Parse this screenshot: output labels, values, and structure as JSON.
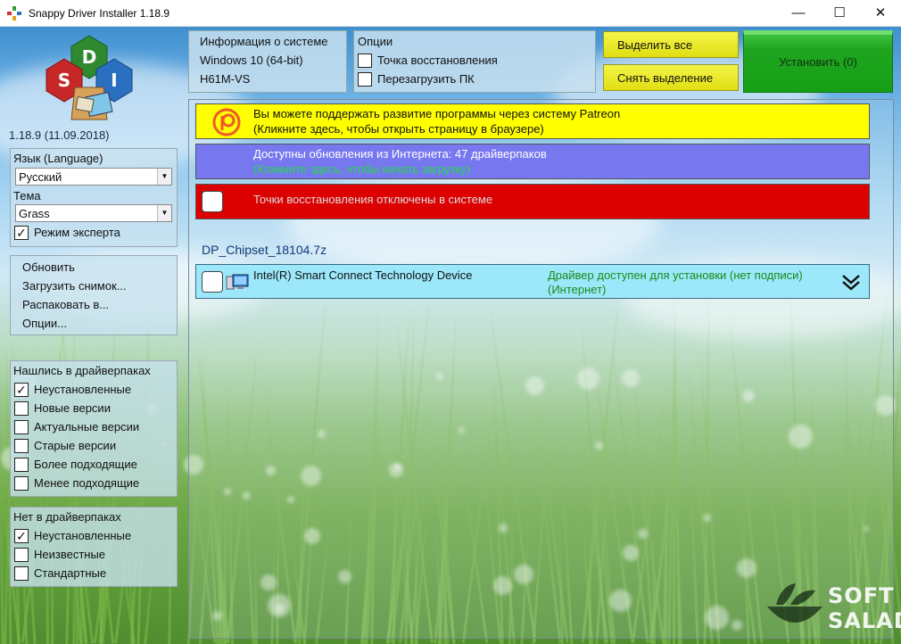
{
  "window": {
    "title": "Snappy Driver Installer 1.18.9",
    "minimize_label": "—",
    "maximize_label": "☐",
    "close_label": "✕"
  },
  "sidebar": {
    "logo_letters": [
      "S",
      "D",
      "I"
    ],
    "version": "1.18.9 (11.09.2018)",
    "language_label": "Язык (Language)",
    "language_value": "Русский",
    "theme_label": "Тема",
    "theme_value": "Grass",
    "expert_mode": {
      "label": "Режим эксперта",
      "checked": true
    },
    "menu": [
      {
        "label": "Обновить"
      },
      {
        "label": "Загрузить снимок..."
      },
      {
        "label": "Распаковать в..."
      },
      {
        "label": "Опции..."
      }
    ],
    "found_in_packs": {
      "title": "Нашлись в драйверпаках",
      "items": [
        {
          "label": "Неустановленные",
          "checked": true
        },
        {
          "label": "Новые версии",
          "checked": false
        },
        {
          "label": "Актуальные версии",
          "checked": false
        },
        {
          "label": "Старые версии",
          "checked": false
        },
        {
          "label": "Более подходящие",
          "checked": false
        },
        {
          "label": "Менее подходящие",
          "checked": false
        }
      ]
    },
    "not_in_packs": {
      "title": "Нет в драйверпаках",
      "items": [
        {
          "label": "Неустановленные",
          "checked": true
        },
        {
          "label": "Неизвестные",
          "checked": false
        },
        {
          "label": "Стандартные",
          "checked": false
        }
      ]
    }
  },
  "sysinfo": {
    "title": "Информация о системе",
    "os": "Windows 10 (64-bit)",
    "board": "H61M-VS"
  },
  "options": {
    "title": "Опции",
    "restore_point": {
      "label": "Точка восстановления",
      "checked": false
    },
    "reboot": {
      "label": "Перезагрузить ПК",
      "checked": false
    }
  },
  "actions": {
    "select_all": "Выделить все",
    "deselect": "Снять выделение",
    "install": "Установить (0)"
  },
  "banners": {
    "patreon": {
      "line1": "Вы можете поддержать развитие программы через систему Patreon",
      "line2": "(Кликните здесь, чтобы открыть страницу в браузере)"
    },
    "updates": {
      "line1": "Доступны обновления из Интернета: 47 драйверпаков",
      "line2": "(Кликните здесь, чтобы начать загрузку)"
    },
    "restore": {
      "line1": "Точки восстановления отключены в системе"
    }
  },
  "drivers": {
    "pack_name": "DP_Chipset_18104.7z",
    "device": {
      "name": "Intel(R) Smart Connect Technology Device",
      "status": "Драйвер доступен для установки (нет подписи) (Интернет)"
    }
  },
  "watermark": {
    "line1": "SOFT",
    "line2": "SALAD"
  },
  "colors": {
    "banner_yellow": "#ffff00",
    "banner_blue": "#7777f0",
    "banner_red": "#dd0000",
    "install_green": "#1fa51f",
    "device_row": "#9ce8fa",
    "status_green": "#1a8a1a",
    "updates_hint": "#22dd44"
  },
  "icons": {
    "app": "snappy-app-icon",
    "patreon": "patreon-icon",
    "device": "device-icon",
    "expand": "double-chevron-down-icon"
  }
}
